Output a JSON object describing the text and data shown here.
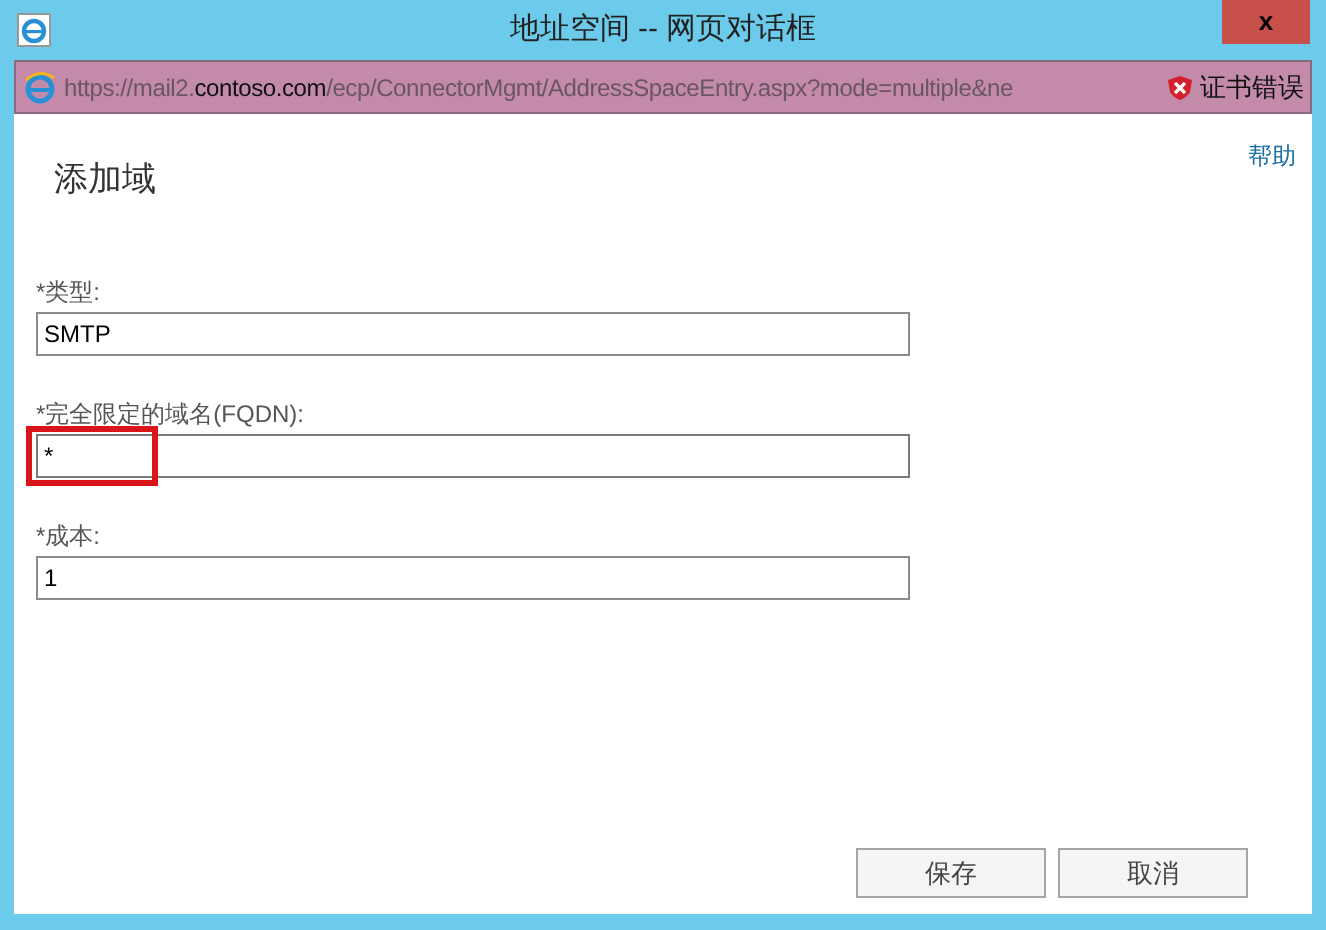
{
  "window": {
    "title": "地址空间 -- 网页对话框",
    "close": "x"
  },
  "address_bar": {
    "scheme": "https://mail2.",
    "host": "contoso.com",
    "path": "/ecp/ConnectorMgmt/AddressSpaceEntry.aspx?mode=multiple&ne",
    "certificate_error": "证书错误"
  },
  "help_link": "帮助",
  "heading": "添加域",
  "fields": [
    {
      "label": "*类型:",
      "value": "SMTP",
      "highlighted": false
    },
    {
      "label": "*完全限定的域名(FQDN):",
      "value": "*",
      "highlighted": true
    },
    {
      "label": "*成本:",
      "value": "1",
      "highlighted": false
    }
  ],
  "buttons": [
    "保存",
    "取消"
  ]
}
